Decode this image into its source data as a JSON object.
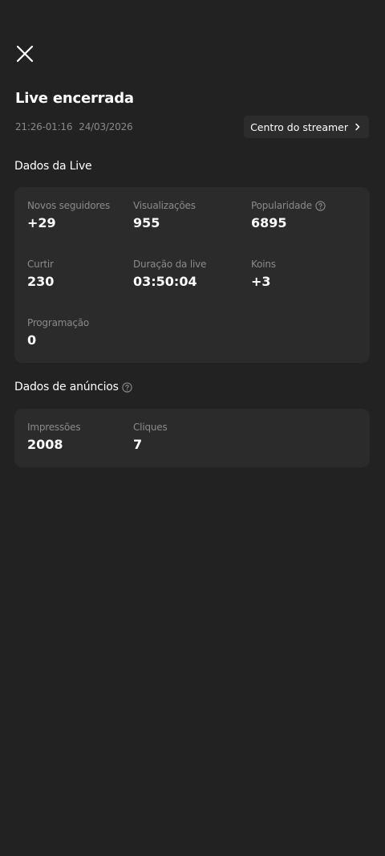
{
  "header": {
    "title": "Live encerrada",
    "time_range": "21:26-01:16",
    "date": "24/03/2026",
    "streamer_center_label": "Centro do streamer"
  },
  "live_data": {
    "section_title": "Dados da Live",
    "stats": [
      {
        "label": "Novos seguidores",
        "value": "+29"
      },
      {
        "label": "Visualizações",
        "value": "955"
      },
      {
        "label": "Popularidade",
        "value": "6895",
        "has_help": true
      },
      {
        "label": "Curtir",
        "value": "230"
      },
      {
        "label": "Duração da live",
        "value": "03:50:04"
      },
      {
        "label": "Koins",
        "value": "+3"
      },
      {
        "label": "Programação",
        "value": "0"
      }
    ]
  },
  "ads_data": {
    "section_title": "Dados de anúncios",
    "stats": [
      {
        "label": "Impressões",
        "value": "2008"
      },
      {
        "label": "Cliques",
        "value": "7"
      }
    ]
  },
  "icons": {
    "close": "close-icon",
    "chevron": "chevron-right-icon",
    "help": "help-circle-icon"
  },
  "colors": {
    "background": "#222222",
    "card": "#2b2b2b",
    "muted_text": "#8a8a8a",
    "text": "#ffffff"
  }
}
